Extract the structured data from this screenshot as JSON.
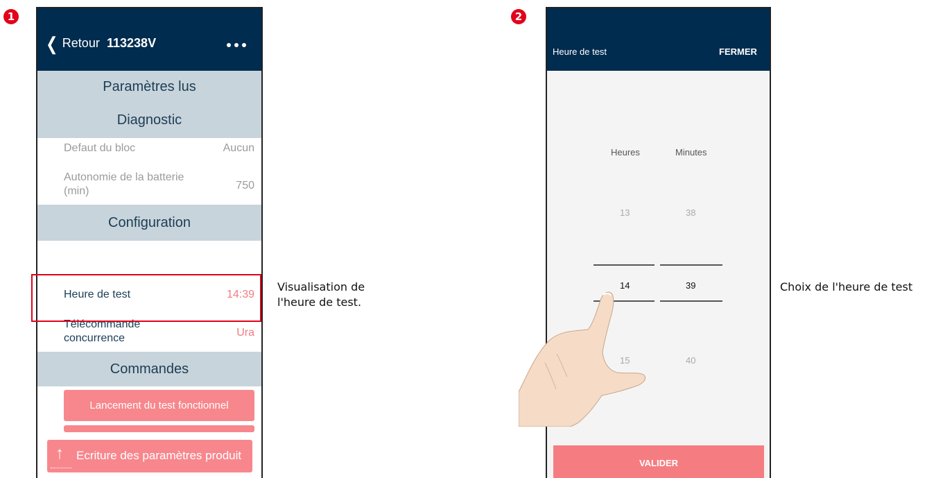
{
  "steps": [
    "1",
    "2"
  ],
  "screen1": {
    "back_label": "Retour",
    "device_title": "113238V",
    "sections": {
      "read_params": "Paramètres lus",
      "diagnostic": "Diagnostic",
      "configuration": "Configuration",
      "commands": "Commandes"
    },
    "rows": [
      {
        "label": "Defaut du bloc",
        "value": "Aucun"
      },
      {
        "label": "Autonomie de la batterie",
        "label2": "(min)",
        "value": "750"
      },
      {
        "label": "Heure de test",
        "value": "14:39"
      },
      {
        "label": "Télécommande",
        "label2": "concurrence",
        "value": "Ura"
      }
    ],
    "buttons": {
      "functional_test": "Lancement du test fonctionnel",
      "write_params": "Ecriture des paramètres produit"
    },
    "upload_glyph": "↑"
  },
  "caption1_line1": "Visualisation de",
  "caption1_line2": "l'heure de test.",
  "screen2": {
    "title": "Heure de test",
    "close_label": "FERMER",
    "hours_header": "Heures",
    "minutes_header": "Minutes",
    "hours": [
      "13",
      "14",
      "15"
    ],
    "minutes": [
      "38",
      "39",
      "40"
    ],
    "validate_label": "VALIDER"
  },
  "caption2": "Choix de l'heure de test",
  "colors": {
    "navy": "#002c4f",
    "section_bg": "#c8d4db",
    "accent_pink": "#f7878c",
    "highlight_red": "#e2001a"
  }
}
